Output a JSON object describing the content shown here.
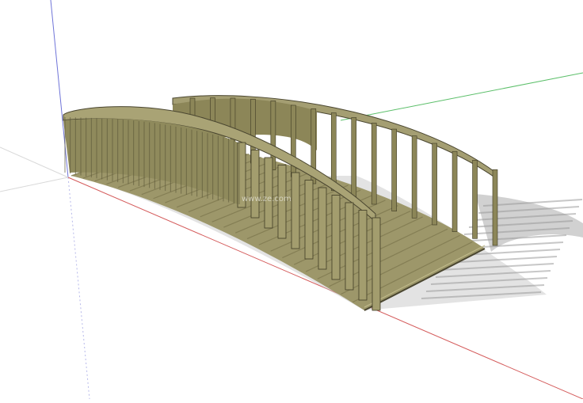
{
  "scene": {
    "background": "#ffffff",
    "axes": {
      "red": "#d45a5a",
      "green": "#5cbf6a",
      "blue": "#6f74d8",
      "gray": "#cfcfcf"
    },
    "materials": {
      "wood_light": "#a39d6e",
      "wood_mid": "#8c8658",
      "wood_dark": "#6c6844",
      "wood_edge": "#3f3b25",
      "shadow": "#bdbdbd"
    },
    "watermark": "www.ze.com"
  }
}
